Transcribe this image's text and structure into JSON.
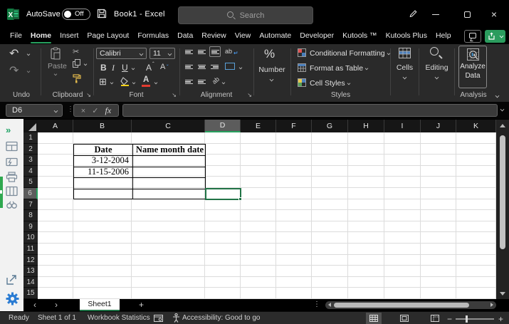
{
  "titlebar": {
    "autosave_label": "AutoSave",
    "autosave_state": "Off",
    "title": "Book1 - Excel",
    "search_placeholder": "Search"
  },
  "ribbon_tabs": {
    "items": [
      "File",
      "Home",
      "Insert",
      "Page Layout",
      "Formulas",
      "Data",
      "Review",
      "View",
      "Automate",
      "Developer",
      "Kutools ™",
      "Kutools Plus",
      "Help"
    ],
    "active": "Home"
  },
  "ribbon": {
    "undo_label": "Undo",
    "clipboard_label": "Clipboard",
    "paste_label": "Paste",
    "font_label": "Font",
    "font_name": "Calibri",
    "font_size": "11",
    "alignment_label": "Alignment",
    "number_label": "Number",
    "styles_label": "Styles",
    "styles_items": [
      "Conditional Formatting",
      "Format as Table",
      "Cell Styles"
    ],
    "cells_label": "Cells",
    "editing_label": "Editing",
    "analyze_line1": "Analyze",
    "analyze_line2": "Data",
    "analysis_label": "Analysis"
  },
  "formula_bar": {
    "name_box": "D6",
    "value": ""
  },
  "sheet": {
    "columns": [
      "A",
      "B",
      "C",
      "D",
      "E",
      "F",
      "G",
      "H",
      "I",
      "J",
      "K"
    ],
    "rows": [
      "1",
      "2",
      "3",
      "4",
      "5",
      "6",
      "7",
      "8",
      "9",
      "10",
      "11",
      "12",
      "13",
      "14",
      "15"
    ],
    "active_column": "D",
    "active_row": "6",
    "selected_cell": "D6",
    "cells": {
      "b2": {
        "text": "Date"
      },
      "c2": {
        "text": "Name month date"
      },
      "b3": {
        "text": "3-12-2004"
      },
      "b4": {
        "text": "11-15-2006"
      }
    }
  },
  "sheet_tabs": {
    "active": "Sheet1"
  },
  "status_bar": {
    "mode": "Ready",
    "sheet_info": "Sheet 1 of 1",
    "workbook_stats": "Workbook Statistics",
    "accessibility": "Accessibility: Good to go"
  },
  "glyphs": {
    "undo": "↶",
    "redo": "↷",
    "cut": "✂",
    "cancel": "×",
    "check": "✓",
    "fx": "fx",
    "percent": "%",
    "bold": "B",
    "italic": "I",
    "underline": "U",
    "grow_font": "A",
    "shrink_font": "A",
    "chevrons": "»",
    "prev": "‹",
    "next": "›",
    "add": "+",
    "dots": "⋮",
    "minus": "−",
    "plus": "+",
    "close": "×",
    "borders": "⊞",
    "wrap": "ab",
    "orient": "ab"
  },
  "colors": {
    "excel_green": "#107c41",
    "accent_green": "#27a05f",
    "share_green": "#2b9c5e",
    "selection_green": "#217346",
    "gear_blue": "#2b7cd3",
    "fill_yellow": "#f7d117",
    "font_red": "#e23b30"
  }
}
